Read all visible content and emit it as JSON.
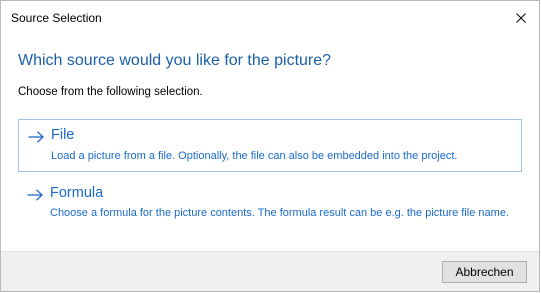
{
  "window": {
    "title": "Source Selection",
    "close_icon": "close-icon"
  },
  "main": {
    "heading": "Which source would you like for the picture?",
    "subheading": "Choose from the following selection.",
    "options": [
      {
        "title": "File",
        "description": "Load a picture from a file. Optionally, the file can also be embedded into the project.",
        "icon": "arrow-right-icon",
        "selected": true
      },
      {
        "title": "Formula",
        "description": "Choose a formula for the picture contents. The formula result can be e.g. the picture file name.",
        "icon": "arrow-right-icon",
        "selected": false
      }
    ]
  },
  "footer": {
    "cancel_label": "Abbrechen"
  },
  "colors": {
    "heading": "#1b5fa8",
    "link": "#1b6ac9",
    "selected_border": "#9ec6e8",
    "footer_bg": "#f0f0f0"
  }
}
